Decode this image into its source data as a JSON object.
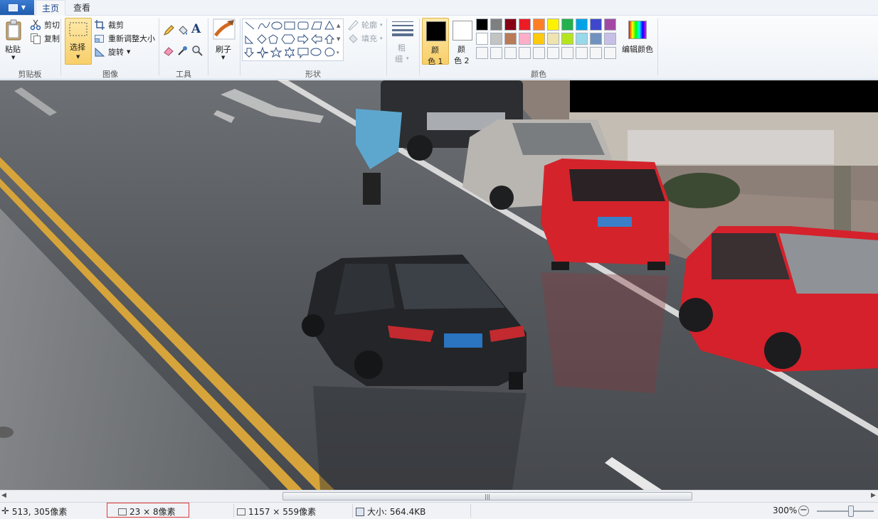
{
  "tabs": {
    "home": "主页",
    "view": "查看"
  },
  "clipboard": {
    "paste": "粘贴",
    "cut": "剪切",
    "copy": "复制",
    "group": "剪贴板"
  },
  "image": {
    "select": "选择",
    "crop": "裁剪",
    "resize": "重新调整大小",
    "rotate": "旋转",
    "group": "图像"
  },
  "tools": {
    "group": "工具"
  },
  "brush": {
    "label": "刷子"
  },
  "shapes": {
    "outline": "轮廓",
    "fill": "填充",
    "group": "形状"
  },
  "size": {
    "label_top": "粗",
    "label_bottom": "细"
  },
  "colors": {
    "color1_top": "颜",
    "color1_bottom": "色 1",
    "color2_top": "颜",
    "color2_bottom": "色 2",
    "edit": "编辑颜色",
    "group": "颜色",
    "row1": [
      "#000000",
      "#7f7f7f",
      "#880015",
      "#ed1c24",
      "#ff7f27",
      "#fff200",
      "#22b14c",
      "#00a2e8",
      "#3f48cc",
      "#a349a4"
    ],
    "row2": [
      "#ffffff",
      "#c3c3c3",
      "#b97a57",
      "#ffaec9",
      "#ffc90e",
      "#efe4b0",
      "#b5e61d",
      "#99d9ea",
      "#7092be",
      "#c8bfe7"
    ],
    "row3": [
      "#f5f6f7",
      "#f5f6f7",
      "#f5f6f7",
      "#f5f6f7",
      "#f5f6f7",
      "#f5f6f7",
      "#f5f6f7",
      "#f5f6f7",
      "#f5f6f7",
      "#f5f6f7"
    ]
  },
  "status": {
    "cursor": "513, 305像素",
    "selection": "23 × 8像素",
    "dimensions": "1157 × 559像素",
    "filesize": "大小: 564.4KB",
    "zoom": "300%"
  }
}
